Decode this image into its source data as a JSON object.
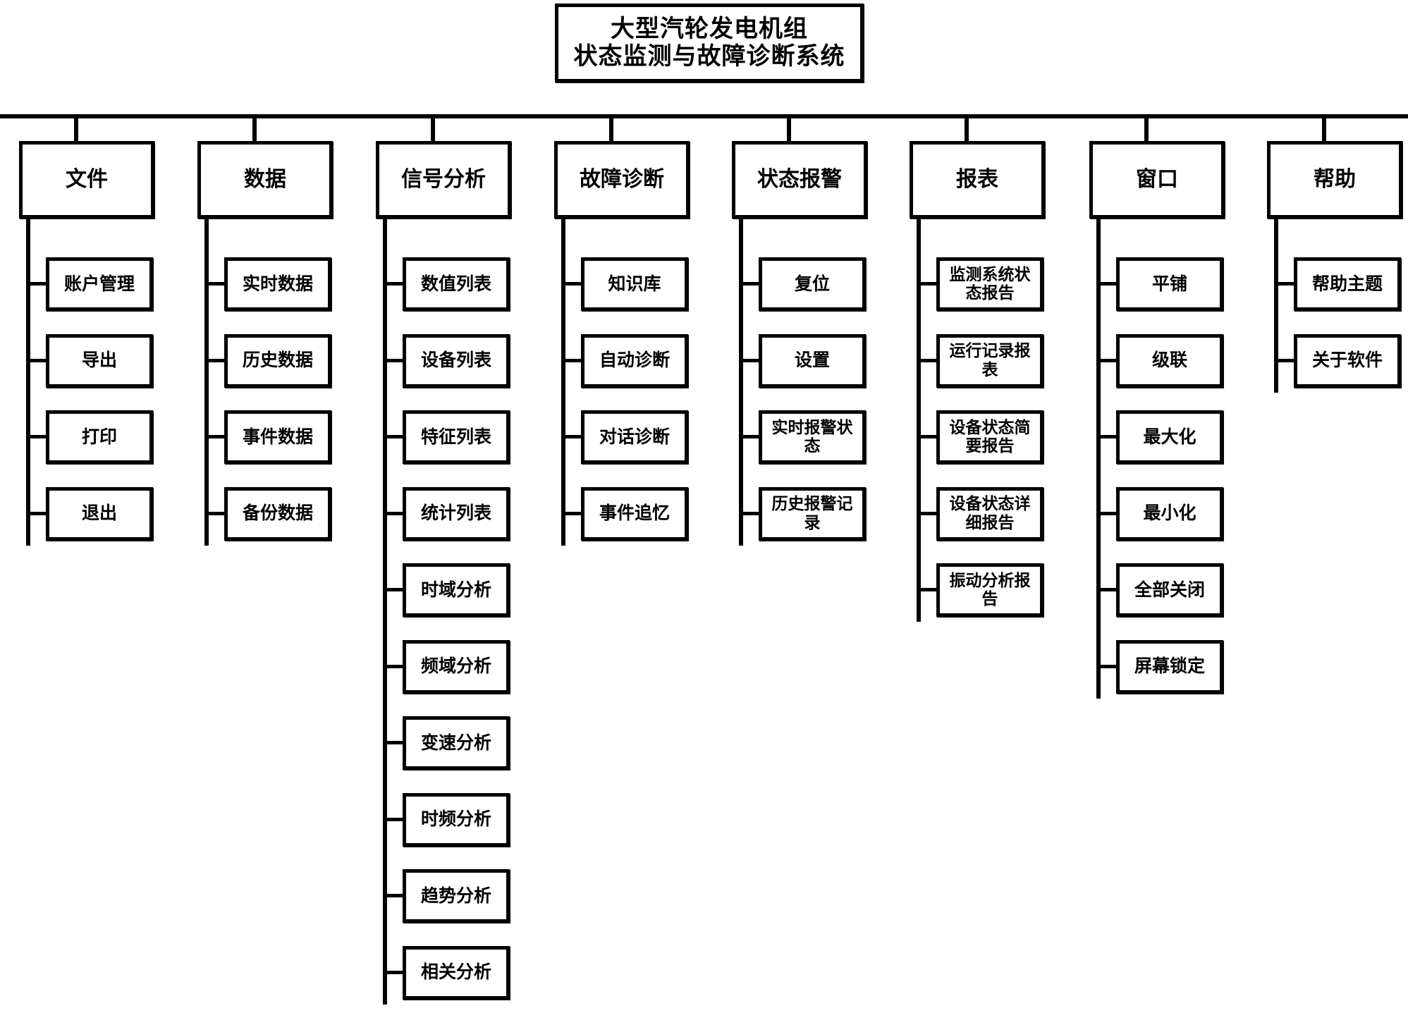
{
  "title": {
    "line1": "大型汽轮发电机组",
    "line2": "状态监测与故障诊断系统"
  },
  "menus": [
    {
      "label": "文件",
      "items": [
        "账户管理",
        "导出",
        "打印",
        "退出"
      ]
    },
    {
      "label": "数据",
      "items": [
        "实时数据",
        "历史数据",
        "事件数据",
        "备份数据"
      ]
    },
    {
      "label": "信号分析",
      "items": [
        "数值列表",
        "设备列表",
        "特征列表",
        "统计列表",
        "时域分析",
        "频域分析",
        "变速分析",
        "时频分析",
        "趋势分析",
        "相关分析"
      ]
    },
    {
      "label": "故障诊断",
      "items": [
        "知识库",
        "自动诊断",
        "对话诊断",
        "事件追忆"
      ]
    },
    {
      "label": "状态报警",
      "items": [
        "复位",
        "设置",
        "实时报警状态",
        "历史报警记录"
      ]
    },
    {
      "label": "报表",
      "items": [
        "监测系统状态报告",
        "运行记录报表",
        "设备状态简要报告",
        "设备状态详细报告",
        "振动分析报告"
      ]
    },
    {
      "label": "窗口",
      "items": [
        "平铺",
        "级联",
        "最大化",
        "最小化",
        "全部关闭",
        "屏幕锁定"
      ]
    },
    {
      "label": "帮助",
      "items": [
        "帮助主题",
        "关于软件"
      ]
    }
  ]
}
